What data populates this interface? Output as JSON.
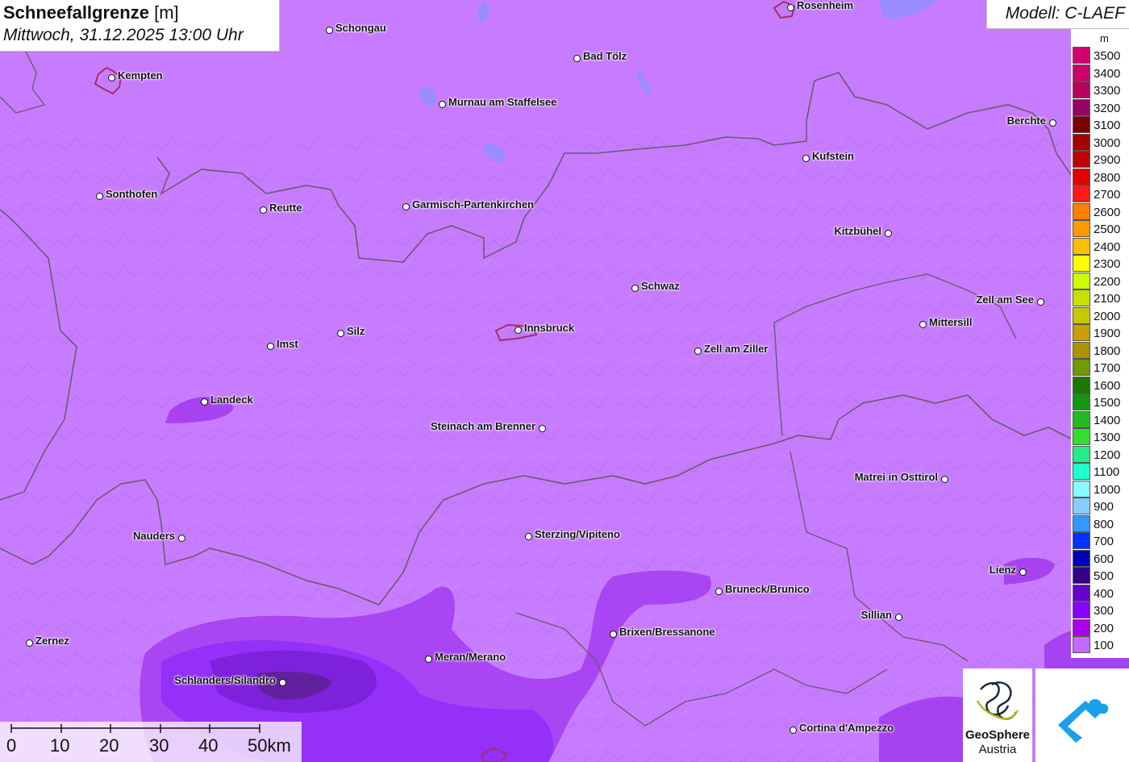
{
  "header": {
    "title_bold": "Schneefallgrenze",
    "title_unit": "[m]",
    "datetime": "Mittwoch, 31.12.2025 13:00 Uhr"
  },
  "model": {
    "label": "Modell: C-LAEF"
  },
  "legend": {
    "unit": "m",
    "items": [
      {
        "label": "3500",
        "color": "#d4006e"
      },
      {
        "label": "3400",
        "color": "#cc0066"
      },
      {
        "label": "3300",
        "color": "#b8005e"
      },
      {
        "label": "3200",
        "color": "#990066"
      },
      {
        "label": "3100",
        "color": "#7a0000"
      },
      {
        "label": "3000",
        "color": "#a60000"
      },
      {
        "label": "2900",
        "color": "#c00000"
      },
      {
        "label": "2800",
        "color": "#e00000"
      },
      {
        "label": "2700",
        "color": "#ff1a1a"
      },
      {
        "label": "2600",
        "color": "#ff7f00"
      },
      {
        "label": "2500",
        "color": "#ff9900"
      },
      {
        "label": "2400",
        "color": "#ffbf00"
      },
      {
        "label": "2300",
        "color": "#ffff00"
      },
      {
        "label": "2200",
        "color": "#ccff00"
      },
      {
        "label": "2100",
        "color": "#c8e000"
      },
      {
        "label": "2000",
        "color": "#c8c800"
      },
      {
        "label": "1900",
        "color": "#c8a000"
      },
      {
        "label": "1800",
        "color": "#a89600"
      },
      {
        "label": "1700",
        "color": "#6f9a00"
      },
      {
        "label": "1600",
        "color": "#1a7a00"
      },
      {
        "label": "1500",
        "color": "#119911"
      },
      {
        "label": "1400",
        "color": "#22bb22"
      },
      {
        "label": "1300",
        "color": "#33dd33"
      },
      {
        "label": "1200",
        "color": "#22ee88"
      },
      {
        "label": "1100",
        "color": "#22ffcc"
      },
      {
        "label": "1000",
        "color": "#88ffff"
      },
      {
        "label": "900",
        "color": "#88ccff"
      },
      {
        "label": "800",
        "color": "#3399ff"
      },
      {
        "label": "700",
        "color": "#0033ff"
      },
      {
        "label": "600",
        "color": "#0000bb"
      },
      {
        "label": "500",
        "color": "#330088"
      },
      {
        "label": "400",
        "color": "#6600cc"
      },
      {
        "label": "300",
        "color": "#8800ff"
      },
      {
        "label": "200",
        "color": "#aa00ee"
      },
      {
        "label": "100",
        "color": "#c06aff"
      }
    ]
  },
  "scalebar": {
    "ticks": [
      "0",
      "10",
      "20",
      "30",
      "40",
      "50km"
    ]
  },
  "cities": [
    {
      "name": "Rosenheim"
    },
    {
      "name": "Schongau"
    },
    {
      "name": "Kempten"
    },
    {
      "name": "Bad Tölz"
    },
    {
      "name": "Murnau am Staffelsee"
    },
    {
      "name": "Berchte"
    },
    {
      "name": "Kufstein"
    },
    {
      "name": "Sonthofen"
    },
    {
      "name": "Reutte"
    },
    {
      "name": "Garmisch-Partenkirchen"
    },
    {
      "name": "Kitzbühel"
    },
    {
      "name": "Schwaz"
    },
    {
      "name": "Zell am See"
    },
    {
      "name": "Mittersill"
    },
    {
      "name": "Innsbruck"
    },
    {
      "name": "Silz"
    },
    {
      "name": "Imst"
    },
    {
      "name": "Zell am Ziller"
    },
    {
      "name": "Landeck"
    },
    {
      "name": "Steinach am Brenner"
    },
    {
      "name": "Matrei in Osttirol"
    },
    {
      "name": "Nauders"
    },
    {
      "name": "Sterzing/Vipiteno"
    },
    {
      "name": "Lienz"
    },
    {
      "name": "Bruneck/Brunico"
    },
    {
      "name": "Sillian"
    },
    {
      "name": "Brixen/Bressanone"
    },
    {
      "name": "Zernez"
    },
    {
      "name": "Meran/Merano"
    },
    {
      "name": "Schlanders/Silandro"
    },
    {
      "name": "Cortina d'Ampezzo"
    }
  ],
  "logos": {
    "geosphere_line1": "GeoSphere",
    "geosphere_line2": "Austria"
  }
}
